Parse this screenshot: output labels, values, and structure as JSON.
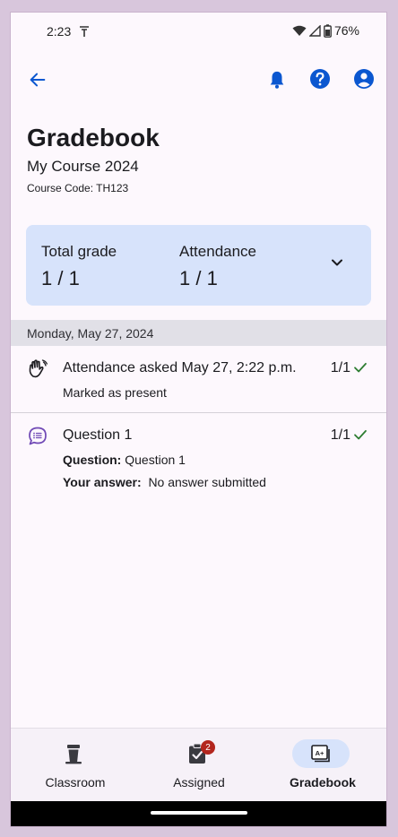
{
  "status_bar": {
    "time": "2:23",
    "battery": "76%"
  },
  "header": {
    "title": "Gradebook",
    "course_name": "My Course 2024",
    "course_code": "Course Code: TH123"
  },
  "summary": {
    "total_grade_label": "Total grade",
    "total_grade_value": "1 / 1",
    "attendance_label": "Attendance",
    "attendance_value": "1 / 1"
  },
  "date_header": "Monday, May 27, 2024",
  "items": [
    {
      "icon": "hand-wave-icon",
      "title": "Attendance asked May 27, 2:22 p.m.",
      "score": "1/1",
      "detail": "Marked as present"
    },
    {
      "icon": "chat-list-icon",
      "title": "Question 1",
      "score": "1/1",
      "question_label": "Question:",
      "question_value": "Question 1",
      "answer_label": "Your answer:",
      "answer_value": "No answer submitted"
    }
  ],
  "bottom_nav": [
    {
      "label": "Classroom",
      "icon": "podium-icon"
    },
    {
      "label": "Assigned",
      "icon": "clipboard-check-icon",
      "badge": "2"
    },
    {
      "label": "Gradebook",
      "icon": "grade-card-icon",
      "active": true
    }
  ],
  "colors": {
    "accent": "#0b57d0",
    "card": "#d7e3fb",
    "check": "#2e7d32",
    "badge": "#b3261e"
  }
}
